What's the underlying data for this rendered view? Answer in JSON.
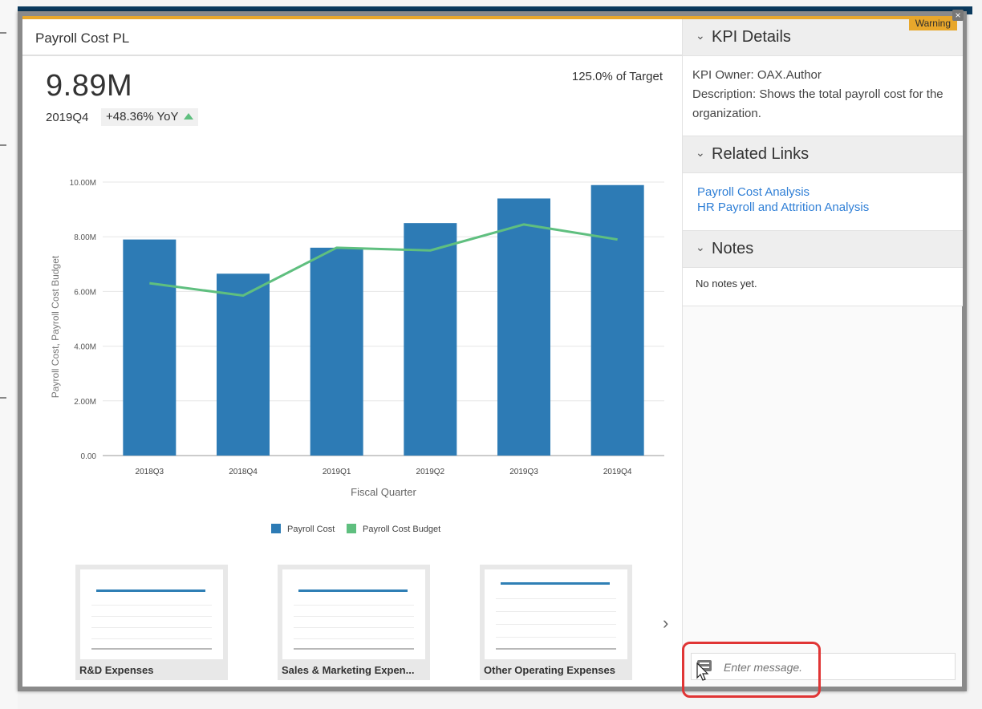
{
  "colors": {
    "bar": "#2d7bb5",
    "line": "#5fbf7f",
    "accent": "#e8a72b",
    "link": "#2f7fd6"
  },
  "dialog": {
    "warning_label": "Warning",
    "close_icon": "close-icon"
  },
  "left_panel": {
    "title": "Payroll Cost PL",
    "kpi_value": "9.89M",
    "kpi_period": "2019Q4",
    "kpi_yoy": "+48.36%  YoY",
    "kpi_target": "125.0% of Target"
  },
  "chart_data": {
    "type": "bar",
    "categories": [
      "2018Q3",
      "2018Q4",
      "2019Q1",
      "2019Q2",
      "2019Q3",
      "2019Q4"
    ],
    "series": [
      {
        "name": "Payroll Cost",
        "type": "bar",
        "values": [
          7.9,
          6.65,
          7.6,
          8.5,
          9.4,
          9.89
        ]
      },
      {
        "name": "Payroll Cost Budget",
        "type": "line",
        "values": [
          6.3,
          5.85,
          7.6,
          7.5,
          8.45,
          7.9
        ]
      }
    ],
    "xlabel": "Fiscal Quarter",
    "ylabel": "Payroll Cost, Payroll Cost Budget",
    "ylim": [
      0,
      10
    ],
    "yticks": [
      "0.00",
      "2.00M",
      "4.00M",
      "6.00M",
      "8.00M",
      "10.00M"
    ],
    "grid": true,
    "legend_position": "bottom"
  },
  "thumbnails": [
    {
      "label": "R&D Expenses"
    },
    {
      "label": "Sales & Marketing Expen..."
    },
    {
      "label": "Other Operating Expenses"
    }
  ],
  "right_panel": {
    "kpi_details": {
      "title": "KPI Details",
      "owner": "KPI Owner: OAX.Author",
      "description": "Description: Shows the total payroll cost for the organization."
    },
    "related_links": {
      "title": "Related Links",
      "links": [
        "Payroll Cost Analysis",
        "HR Payroll and Attrition Analysis"
      ]
    },
    "notes": {
      "title": "Notes",
      "empty_text": "No notes yet."
    },
    "message": {
      "placeholder": "Enter message."
    }
  }
}
